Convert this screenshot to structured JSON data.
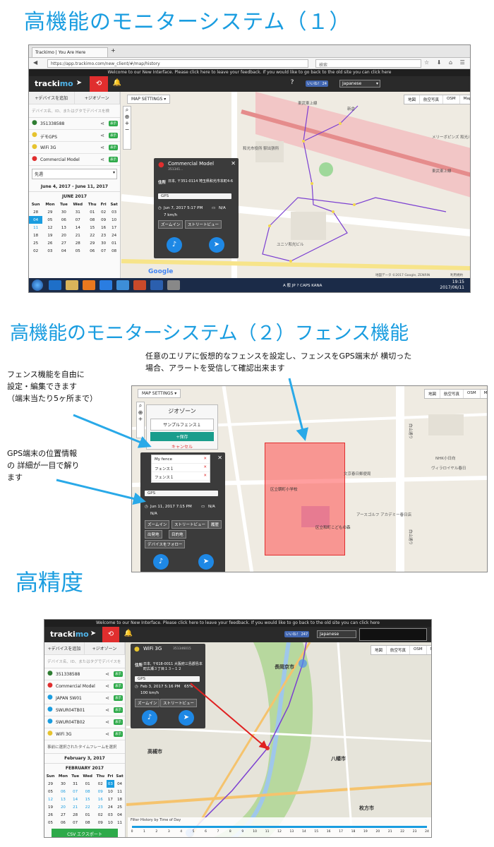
{
  "headings": {
    "h1": "高機能のモニターシステム（１）",
    "h2": "高機能のモニターシステム（２）フェンス機能",
    "h3": "高精度"
  },
  "shot1": {
    "tab_title": "Trackimo | You Are Here",
    "url": "https://app.trackimo.com/new_client/#/map/history",
    "search_placeholder": "検索",
    "notice": "Welcome to our New Interface. Please click here to leave your feedback. If you would like to go back to the old site you can click here",
    "logo_track": "tracki",
    "logo_mo": "mo",
    "fb_like": "いいね！ 24",
    "language": "Japanese",
    "add_device": "+デバイスを追加",
    "geozone": "+ジオゾーン",
    "device_search_placeholder": "デバイス名、ID、またはグタでデバイスを検",
    "devices": [
      {
        "name": "351338588",
        "pin_color": "#2e7d32",
        "show": "表示"
      },
      {
        "name": "デモGPS",
        "pin_color": "#e6c32e",
        "show": "表示"
      },
      {
        "name": "WiFi 3G",
        "pin_color": "#e6c32e",
        "show": "表示"
      },
      {
        "name": "Commercial Model",
        "pin_color": "#e02e2e",
        "show": "表示"
      }
    ],
    "period": "先週",
    "date_range": "June 4, 2017 - June 11, 2017",
    "calendar_month": "JUNE 2017",
    "weekdays": [
      "Sun",
      "Mon",
      "Tue",
      "Wed",
      "Thu",
      "Fri",
      "Sat"
    ],
    "calendar_rows": [
      [
        "28",
        "29",
        "30",
        "31",
        "01",
        "02",
        "03"
      ],
      [
        "04",
        "05",
        "06",
        "07",
        "08",
        "09",
        "10"
      ],
      [
        "11",
        "12",
        "13",
        "14",
        "15",
        "16",
        "17"
      ],
      [
        "18",
        "19",
        "20",
        "21",
        "22",
        "23",
        "24"
      ],
      [
        "25",
        "26",
        "27",
        "28",
        "29",
        "30",
        "01"
      ],
      [
        "02",
        "03",
        "04",
        "05",
        "06",
        "07",
        "08"
      ]
    ],
    "map_settings": "MAP SETTINGS ▾",
    "map_types": [
      "地図",
      "航空写真",
      "OSM",
      "MapBox"
    ],
    "popup": {
      "title": "Commercial Model",
      "id": "351341...",
      "address_label": "住所",
      "address": "日本, 〒351-0114 埼玉県和光市本町4-6",
      "gps": "GPS",
      "time": "Jun 7, 2017 5:17 PM",
      "battery": "N/A",
      "speed": "7 km/h",
      "btn_zoom": "ズームイン",
      "btn_street": "ストリートビュー"
    },
    "map_labels": [
      "東武東上線",
      "新倉",
      "和光市役所 駅出張所",
      "ユニソ和光ビル",
      "メリーボピンズ 和光ルーム",
      "東武東上線",
      "Google",
      "地図データ ©2017 Google, ZENRIN",
      "利用規約"
    ],
    "clock_time": "19:15",
    "clock_date": "2017/06/11",
    "tray": "A 般 JP ? CAPS KANA"
  },
  "shot2": {
    "callouts": {
      "left_top": [
        "フェンス機能を自由に",
        "設定・編集できます",
        "（端末当たり5ヶ所まで）"
      ],
      "left_bottom": [
        "GPS端末の位置情報",
        "の 詳細が一目で解り",
        "ます"
      ],
      "top": [
        "任意のエリアに仮想的なフェンスを設定し、フェンスをGPS端末が 横切った",
        "場合、アラートを受信して確認出来ます"
      ]
    },
    "map_settings": "MAP SETTINGS ▾",
    "map_types": [
      "地図",
      "航空写真",
      "OSM",
      "MapBox"
    ],
    "geozone_title": "ジオゾーン",
    "fence_input": "サンプルフェンス１",
    "save_label": "+保存",
    "cancel_label": "キャンセル",
    "fences": [
      "My fence",
      "フェンス１",
      "フェンス１"
    ],
    "gps": "GPS",
    "time": "Jun 11, 2017 7:15 PM",
    "battery": "N/A",
    "speed": "N/A",
    "buttons": [
      "ズームイン",
      "ストリートビュー",
      "履歴",
      "出発地",
      "目的地",
      "デバイスをフォロー"
    ],
    "map_labels": [
      "区立朝町小学校",
      "区立和町こどもの森",
      "アースゴルフ アカデミー春日店",
      "NHK小日向",
      "文京春日郵便局",
      "白山通り",
      "白山通り",
      "ヴィラロイヤル春日"
    ]
  },
  "shot3": {
    "notice": "Welcome to our New Interface. Please click here to leave your feedback. If you would like to go back to the old site you can click here",
    "logo_track": "tracki",
    "logo_mo": "mo",
    "fb_like": "いいね！ 247",
    "language": "Japanese",
    "add_device": "+デバイスを追加",
    "geozone": "+ジオゾーン",
    "device_search_placeholder": "デバイス名、ID、またはタグでデバイスを",
    "devices": [
      {
        "name": "351338588",
        "pin_color": "#2e7d32",
        "show": "表示"
      },
      {
        "name": "Commercial Model",
        "pin_color": "#e02e2e",
        "show": "表示"
      },
      {
        "name": "JAPAN   SW01",
        "pin_color": "#1a9de0",
        "show": "表示"
      },
      {
        "name": "SWUR04TB01",
        "pin_color": "#1a9de0",
        "show": "表示"
      },
      {
        "name": "SWUR04TB02",
        "pin_color": "#1a9de0",
        "show": "表示"
      },
      {
        "name": "WiFi 3G",
        "pin_color": "#e6c32e",
        "show": "表示"
      }
    ],
    "timeframe": "事前に選択されたタイムフレームを選択",
    "date": "February 3, 2017",
    "calendar_month": "FEBRUARY 2017",
    "weekdays": [
      "Sun",
      "Mon",
      "Tue",
      "Wed",
      "Thu",
      "Fri",
      "Sat"
    ],
    "calendar_rows": [
      [
        "29",
        "30",
        "31",
        "01",
        "02",
        "03",
        "04"
      ],
      [
        "05",
        "06",
        "07",
        "08",
        "09",
        "10",
        "11"
      ],
      [
        "12",
        "13",
        "14",
        "15",
        "16",
        "17",
        "18"
      ],
      [
        "19",
        "20",
        "21",
        "22",
        "23",
        "24",
        "25"
      ],
      [
        "26",
        "27",
        "28",
        "01",
        "02",
        "03",
        "04"
      ],
      [
        "05",
        "06",
        "07",
        "08",
        "09",
        "10",
        "11"
      ]
    ],
    "csv_export": "CSV エクスポート",
    "popup": {
      "title": "WiFi 3G",
      "id": "351346015",
      "address_label": "住所",
      "address": "日本, 〒618-0011 大阪府三島郡島本町広瀬３丁目１３−１２",
      "gps": "GPS",
      "time": "Feb 3, 2017 5:16 PM",
      "battery": "65%",
      "speed": "100 km/h",
      "btn_zoom": "ズームイン",
      "btn_street": "ストリートビュー"
    },
    "map_types": [
      "地図",
      "航空写真",
      "OSM",
      "MapBox"
    ],
    "map_labels": [
      "長岡京市",
      "高槻市",
      "八幡市",
      "枚方市"
    ],
    "slider_label": "Filter History by Time of Day",
    "slider_ticks": [
      "0",
      "1",
      "2",
      "3",
      "4",
      "5",
      "6",
      "7",
      "8",
      "9",
      "10",
      "11",
      "12",
      "13",
      "14",
      "15",
      "16",
      "17",
      "18",
      "19",
      "20",
      "21",
      "22",
      "23",
      "24"
    ]
  }
}
